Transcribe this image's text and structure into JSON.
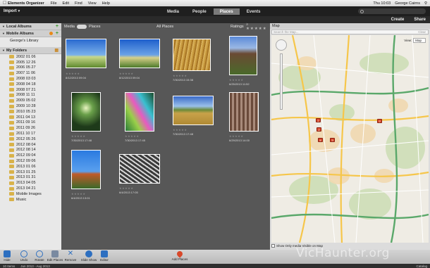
{
  "menubar": {
    "app": "Elements Organizer",
    "items": [
      "File",
      "Edit",
      "Find",
      "View",
      "Help"
    ],
    "clock": "Thu 10:03",
    "user": "George Cairns"
  },
  "header": {
    "import": "Import",
    "tabs": [
      {
        "label": "Media"
      },
      {
        "label": "People"
      },
      {
        "label": "Places"
      },
      {
        "label": "Events"
      }
    ],
    "create": "Create",
    "share": "Share"
  },
  "sidebar": {
    "local_albums": "Local Albums",
    "mobile_albums": "Mobile Albums",
    "georges_library": "George's Library",
    "my_folders": "My Folders",
    "folders": [
      "2002 01 06",
      "2005 12 26",
      "2006 05 27",
      "2007 11 06",
      "2008 03 03",
      "2008 04 18",
      "2008 07 21",
      "2008 11 11",
      "2009 05 02",
      "2009 10 28",
      "2010 05 23",
      "2011 04 13",
      "2011 09 16",
      "2011 09 26",
      "2011 10 17",
      "2012 05 26",
      "2012 08 04",
      "2012 08 14",
      "2012 09 04",
      "2012 09 06",
      "2013 01 06",
      "2013 01 25",
      "2013 01 31",
      "2013 04 05",
      "2013 04 21",
      "Mobile Images",
      "Music"
    ]
  },
  "media_bar": {
    "media": "Media",
    "places": "Places",
    "all_places": "All Places",
    "ratings": "Ratings"
  },
  "photos": [
    {
      "caption": "8/12/2013 09:04"
    },
    {
      "caption": "8/12/2013 09:04"
    },
    {
      "caption": "7/30/2013 15:38"
    },
    {
      "caption": "6/25/2013 11:52"
    },
    {
      "caption": "7/30/2013 17:48"
    },
    {
      "caption": "7/30/2013 17:45"
    },
    {
      "caption": "7/30/2013 17:48"
    },
    {
      "caption": "6/29/2013 14:00"
    },
    {
      "caption": "6/4/2013 13:01"
    },
    {
      "caption": "6/4/2013 17:05"
    }
  ],
  "map": {
    "title": "Map",
    "search_placeholder": "Search the Map...",
    "clear": "Clear",
    "view_label": "View:",
    "view_value": "Map",
    "pins": [
      "2",
      "4",
      "3",
      "2",
      "2"
    ],
    "show_only": "Show Only media Visible on Map"
  },
  "toolbar": {
    "items": [
      "Hide",
      "Undo",
      "Rotate",
      "Edit Places",
      "Remove",
      "Slide Show",
      "Editor"
    ],
    "add_places": "Add Places"
  },
  "status": {
    "items": "10 Items",
    "range": "Jun 2013 - Aug 2013",
    "catalog": "Catalog"
  },
  "watermark": "VicHaunter.org"
}
